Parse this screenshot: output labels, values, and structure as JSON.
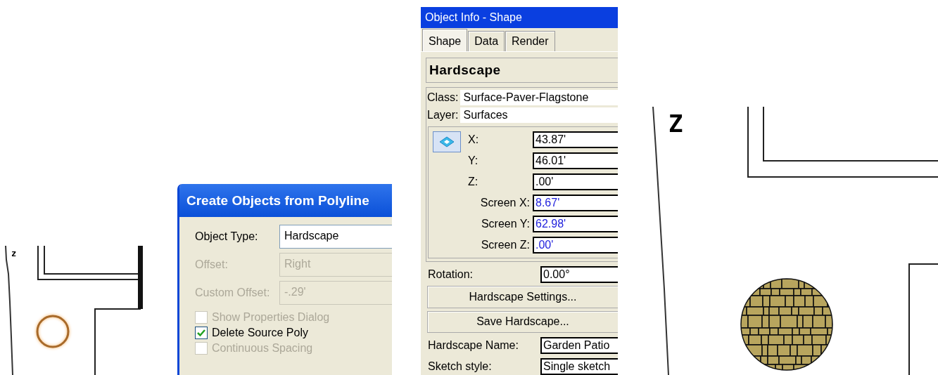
{
  "plan_left": {
    "north_mark": "z"
  },
  "dialog": {
    "title": "Create Objects from Polyline",
    "fields": [
      {
        "label": "Object Type:",
        "value": "Hardscape",
        "disabled": false
      },
      {
        "label": "Offset:",
        "value": "Right",
        "disabled": true
      },
      {
        "label": "Custom Offset:",
        "value": "-.29'",
        "disabled": true
      }
    ],
    "checkboxes": [
      {
        "label": "Show Properties Dialog",
        "checked": false,
        "disabled": true
      },
      {
        "label": "Delete Source Poly",
        "checked": true,
        "disabled": false
      },
      {
        "label": "Continuous Spacing",
        "checked": false,
        "disabled": true
      }
    ]
  },
  "object_info": {
    "title": "Object Info - Shape",
    "tabs": [
      {
        "label": "Shape",
        "selected": true
      },
      {
        "label": "Data",
        "selected": false
      },
      {
        "label": "Render",
        "selected": false
      }
    ],
    "object_type": "Hardscape",
    "class_field": {
      "label": "Class:",
      "value": "Surface-Paver-Flagstone"
    },
    "layer_field": {
      "label": "Layer:",
      "value": "Surfaces"
    },
    "coordinates": [
      {
        "label": "X:",
        "value": "43.87'",
        "kind": "world"
      },
      {
        "label": "Y:",
        "value": "46.01'",
        "kind": "world"
      },
      {
        "label": "Z:",
        "value": ".00'",
        "kind": "world"
      },
      {
        "label": "Screen X:",
        "value": "8.67'",
        "kind": "screen"
      },
      {
        "label": "Screen Y:",
        "value": "62.98'",
        "kind": "screen"
      },
      {
        "label": "Screen Z:",
        "value": ".00'",
        "kind": "screen"
      }
    ],
    "rotation": {
      "label": "Rotation:",
      "value": "0.00°"
    },
    "buttons": [
      "Hardscape Settings...",
      "Save Hardscape..."
    ],
    "properties": [
      {
        "label": "Hardscape Name:",
        "value": "Garden Patio"
      },
      {
        "label": "Sketch style:",
        "value": "Single sketch"
      }
    ]
  },
  "plan_right": {
    "north_mark": "Z"
  }
}
